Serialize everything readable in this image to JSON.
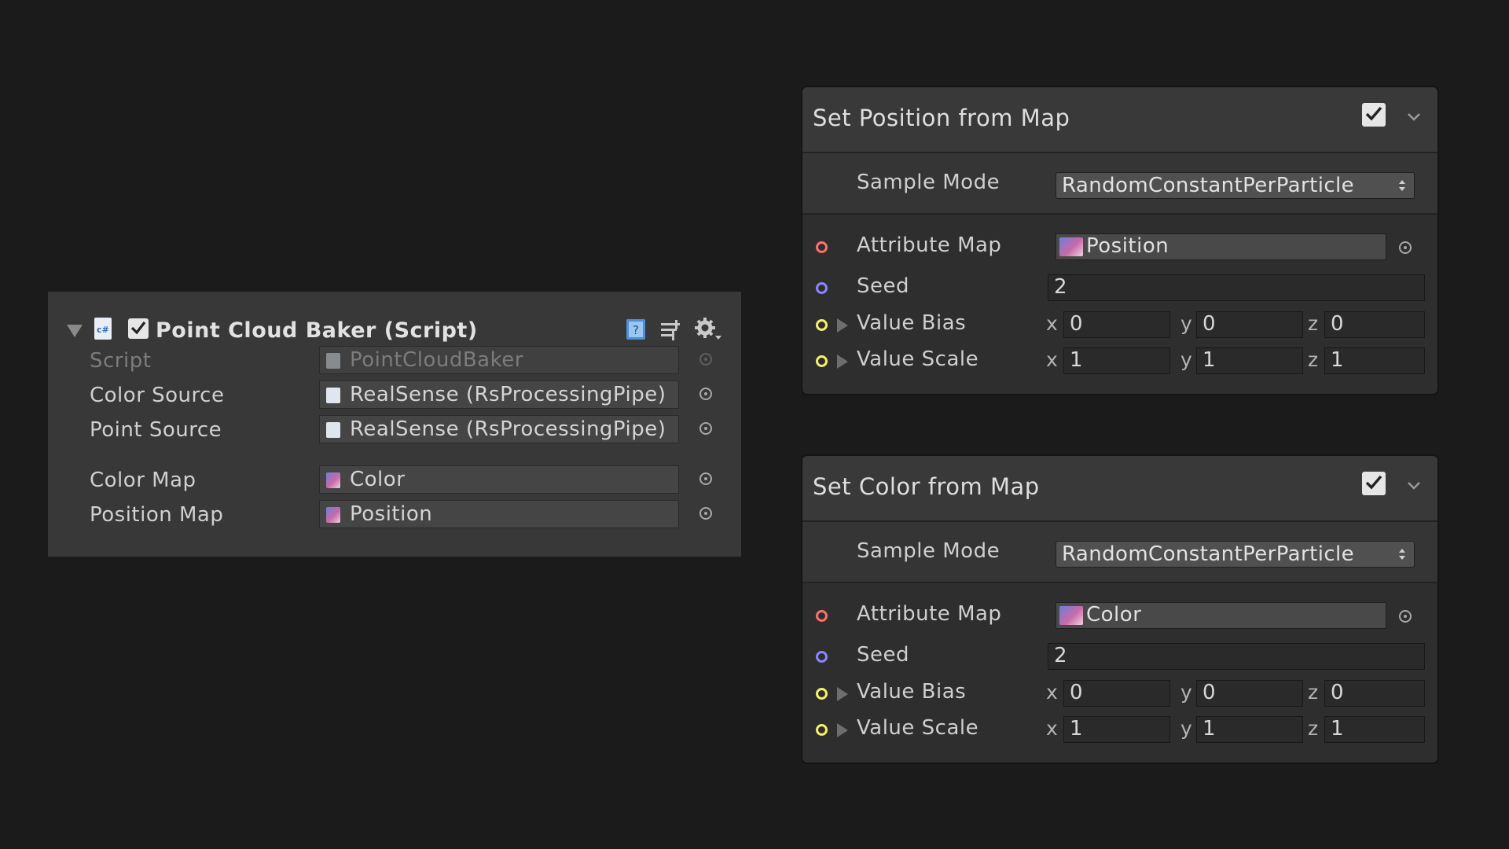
{
  "inspector": {
    "title": "Point Cloud Baker (Script)",
    "enabled": true,
    "icons": [
      "foldout-arrow-icon",
      "csharp-script-icon",
      "help-book-icon",
      "preset-sliders-icon",
      "gear-icon"
    ],
    "rows": [
      {
        "label": "Script",
        "value": "PointCloudBaker",
        "icon": "csharp-script-icon",
        "disabled": true
      },
      {
        "label": "Color Source",
        "value": "RealSense (RsProcessingPipe)",
        "icon": "csharp-script-icon"
      },
      {
        "label": "Point Source",
        "value": "RealSense (RsProcessingPipe)",
        "icon": "csharp-script-icon"
      },
      {
        "label": "Color Map",
        "value": "Color",
        "icon": "texture-icon"
      },
      {
        "label": "Position Map",
        "value": "Position",
        "icon": "texture-icon"
      }
    ]
  },
  "blocks": [
    {
      "title": "Set Position from Map",
      "enabled": true,
      "sample_mode_label": "Sample Mode",
      "sample_mode_value": "RandomConstantPerParticle",
      "attribute_map_label": "Attribute Map",
      "attribute_map_value": "Position",
      "seed_label": "Seed",
      "seed_value": "2",
      "value_bias_label": "Value Bias",
      "value_bias": {
        "x": "0",
        "y": "0",
        "z": "0"
      },
      "value_scale_label": "Value Scale",
      "value_scale": {
        "x": "1",
        "y": "1",
        "z": "1"
      }
    },
    {
      "title": "Set Color from Map",
      "enabled": true,
      "sample_mode_label": "Sample Mode",
      "sample_mode_value": "RandomConstantPerParticle",
      "attribute_map_label": "Attribute Map",
      "attribute_map_value": "Color",
      "seed_label": "Seed",
      "seed_value": "2",
      "value_bias_label": "Value Bias",
      "value_bias": {
        "x": "0",
        "y": "0",
        "z": "0"
      },
      "value_scale_label": "Value Scale",
      "value_scale": {
        "x": "1",
        "y": "1",
        "z": "1"
      }
    }
  ],
  "axis_labels": {
    "x": "x",
    "y": "y",
    "z": "z"
  },
  "colors": {
    "background": "#1b1b1b",
    "inspector_bg": "#383838",
    "port_texture": "#ff6f6f",
    "port_uint": "#8a86ff",
    "port_vector": "#f5f06a"
  }
}
